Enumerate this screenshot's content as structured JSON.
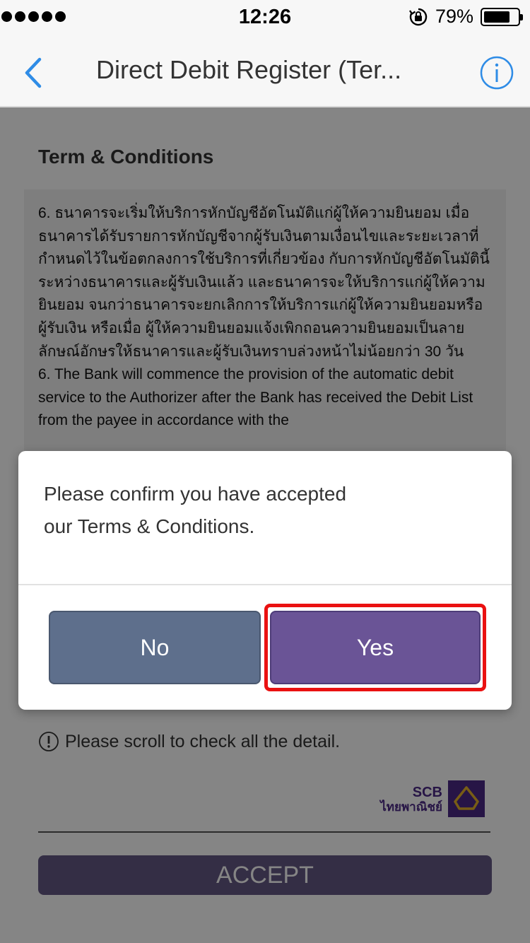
{
  "status_bar": {
    "time": "12:26",
    "battery": "79%",
    "battery_level": 0.79
  },
  "nav": {
    "title": "Direct Debit Register (Ter..."
  },
  "content": {
    "section_title": "Term & Conditions",
    "terms_th": "6. ธนาคารจะเริ่มให้บริการหักบัญชีอัตโนมัติแก่ผู้ให้ความยินยอม เมื่อธนาคารได้รับรายการหักบัญชีจากผู้รับเงินตามเงื่อนไขและระยะเวลาที่กำหนดไว้ในข้อตกลงการใช้บริการที่เกี่ยวข้อง กับการหักบัญชีอัตโนมัตินี้ ระหว่างธนาคารและผู้รับเงินแล้ว และธนาคารจะให้บริการแก่ผู้ให้ความยินยอม จนกว่าธนาคารจะยกเลิกการให้บริการแก่ผู้ให้ความยินยอมหรือผู้รับเงิน หรือเมื่อ ผู้ให้ความยินยอมแจ้งเพิกถอนความยินยอมเป็นลายลักษณ์อักษรให้ธนาคารและผู้รับเงินทราบล่วงหน้าไม่น้อยกว่า 30 วัน",
    "terms_en": "6. The Bank will commence the provision of the automatic debit service to the Authorizer after the Bank has received the Debit List from the payee in accordance with the",
    "scroll_warning": "Please scroll to check all the detail.",
    "logo_line1": "SCB",
    "logo_line2": "ไทยพาณิชย์",
    "accept_label": "ACCEPT"
  },
  "dialog": {
    "message_line1": "Please confirm you have accepted",
    "message_line2": "our Terms & Conditions.",
    "no_label": "No",
    "yes_label": "Yes"
  },
  "colors": {
    "accent_blue": "#2f8ce6",
    "brand_purple": "#4c2a86",
    "yes_button": "#6a5496",
    "no_button": "#5e6f8c",
    "highlight": "#ea1111"
  }
}
